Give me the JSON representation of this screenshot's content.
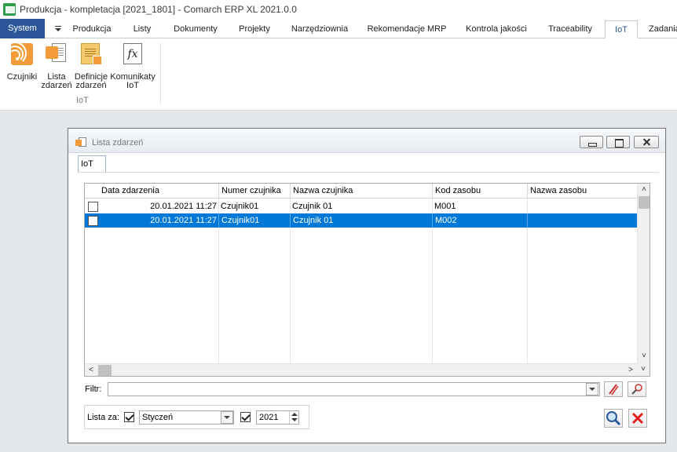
{
  "window": {
    "title": "Produkcja - kompletacja [2021_1801] - Comarch ERP XL 2021.0.0"
  },
  "ribbon": {
    "tabs": [
      "System",
      "Produkcja",
      "Listy",
      "Dokumenty",
      "Projekty",
      "Narzędziownia",
      "Rekomendacje MRP",
      "Kontrola jakości",
      "Traceability",
      "IoT",
      "Zadania"
    ],
    "active_tab": "IoT",
    "buttons": [
      {
        "label": "Czujniki",
        "icon": "sensor-icon"
      },
      {
        "label": "Lista zdarzeń",
        "icon": "event-list-icon"
      },
      {
        "label": "Definicje zdarzeń",
        "icon": "event-definitions-icon"
      },
      {
        "label": "Komunikaty IoT",
        "icon": "fx-icon"
      }
    ],
    "group_label": "IoT"
  },
  "dialog": {
    "title": "Lista zdarzeń",
    "tab": "IoT",
    "columns": [
      "Data zdarzenia",
      "Numer czujnika",
      "Nazwa czujnika",
      "Kod zasobu",
      "Nazwa zasobu"
    ],
    "rows": [
      {
        "data": "20.01.2021 11:27",
        "numer": "Czujnik01",
        "nazwa": "Czujnik 01",
        "kod": "M001",
        "nazwa_zasobu": "",
        "checked": false,
        "selected": false
      },
      {
        "data": "20.01.2021 11:27",
        "numer": "Czujnik01",
        "nazwa": "Czujnik 01",
        "kod": "M002",
        "nazwa_zasobu": "",
        "checked": false,
        "selected": true
      }
    ],
    "filter": {
      "label": "Filtr:",
      "value": ""
    },
    "lista_za": {
      "label": "Lista za:",
      "month_checked": true,
      "month": "Styczeń",
      "year_checked": true,
      "year": "2021"
    }
  },
  "colors": {
    "accent": "#2b579a",
    "selection": "#0078d7",
    "orange": "#f29b38",
    "close_red": "#e02020"
  }
}
